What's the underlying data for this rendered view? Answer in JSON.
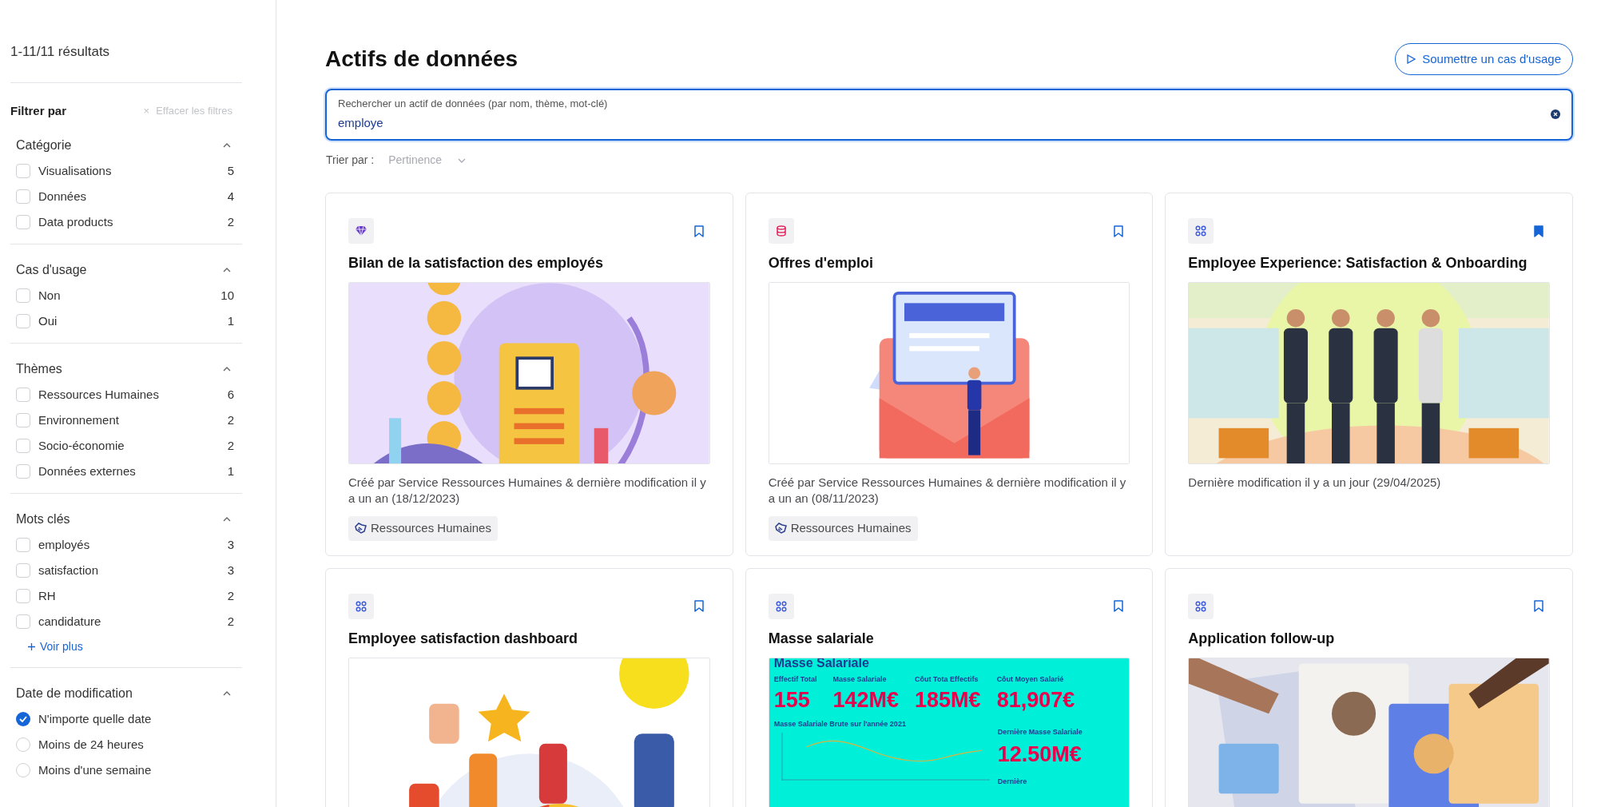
{
  "sidebar": {
    "results": "1-11/11 résultats",
    "filter_title": "Filtrer par",
    "clear_filters": {
      "icon": "×",
      "label": "Effacer les filtres"
    },
    "groups": [
      {
        "title": "Catégorie",
        "expanded": true,
        "kind": "checkbox",
        "items": [
          {
            "label": "Visualisations",
            "count": "5",
            "checked": false
          },
          {
            "label": "Données",
            "count": "4",
            "checked": false
          },
          {
            "label": "Data products",
            "count": "2",
            "checked": false
          }
        ]
      },
      {
        "title": "Cas d'usage",
        "expanded": true,
        "kind": "checkbox",
        "items": [
          {
            "label": "Non",
            "count": "10",
            "checked": false
          },
          {
            "label": "Oui",
            "count": "1",
            "checked": false
          }
        ]
      },
      {
        "title": "Thèmes",
        "expanded": true,
        "kind": "checkbox",
        "items": [
          {
            "label": "Ressources Humaines",
            "count": "6",
            "checked": false
          },
          {
            "label": "Environnement",
            "count": "2",
            "checked": false
          },
          {
            "label": "Socio-économie",
            "count": "2",
            "checked": false
          },
          {
            "label": "Données externes",
            "count": "1",
            "checked": false
          }
        ]
      },
      {
        "title": "Mots clés",
        "expanded": true,
        "kind": "checkbox",
        "items": [
          {
            "label": "employés",
            "count": "3",
            "checked": false
          },
          {
            "label": "satisfaction",
            "count": "3",
            "checked": false
          },
          {
            "label": "RH",
            "count": "2",
            "checked": false
          },
          {
            "label": "candidature",
            "count": "2",
            "checked": false
          }
        ],
        "more": "Voir plus"
      },
      {
        "title": "Date de modification",
        "expanded": true,
        "kind": "radio",
        "items": [
          {
            "label": "N'importe quelle date",
            "selected": true
          },
          {
            "label": "Moins de 24 heures",
            "selected": false
          },
          {
            "label": "Moins d'une semaine",
            "selected": false
          }
        ]
      }
    ]
  },
  "main": {
    "title": "Actifs de données",
    "submit_button": "Soumettre un cas d'usage",
    "search": {
      "label": "Rechercher un actif de données (par nom, thème, mot-clé)",
      "value": "employe"
    },
    "sort": {
      "label": "Trier par :",
      "value": "Pertinence",
      "disabled": true
    },
    "cards": [
      {
        "kind": "gem",
        "bookmarked": false,
        "title": "Bilan de la satisfaction des employés",
        "description": "Créé par Service Ressources Humaines & dernière modification il y a un an (18/12/2023)",
        "tag": "Ressources Humaines"
      },
      {
        "kind": "database",
        "bookmarked": false,
        "title": "Offres d'emploi",
        "description": "Créé par Service Ressources Humaines & dernière modification il y a un an (08/11/2023)",
        "tag": "Ressources Humaines"
      },
      {
        "kind": "grid",
        "bookmarked": true,
        "title": "Employee Experience: Satisfaction & Onboarding",
        "description": "Dernière modification il y a un jour (29/04/2025)"
      },
      {
        "kind": "grid",
        "bookmarked": false,
        "title": "Employee satisfaction dashboard"
      },
      {
        "kind": "grid",
        "bookmarked": false,
        "title": "Masse salariale",
        "image": {
          "kind": "dashboard",
          "heading": "Masse Salariale",
          "kpis": [
            {
              "label": "Effectif Total",
              "value": "155"
            },
            {
              "label": "Masse Salariale",
              "value": "142M€"
            },
            {
              "label": "Côut Tota Effectifs",
              "value": "185M€"
            },
            {
              "label": "Côut Moyen Salarié",
              "value": "81,907€"
            }
          ],
          "chart_title": "Masse Salariale Brute sur l'année 2021",
          "side_label": "Dernière Masse Salariale",
          "side_value": "12.50M€",
          "side_label_2": "Dernière"
        }
      },
      {
        "kind": "grid",
        "bookmarked": false,
        "title": "Application follow-up"
      }
    ]
  }
}
